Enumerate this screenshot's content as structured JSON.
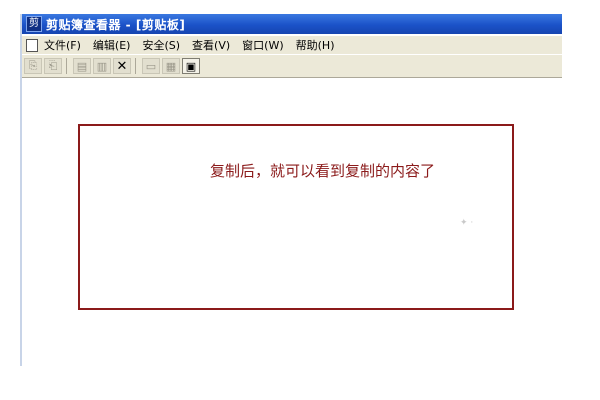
{
  "window": {
    "app_icon": "剪",
    "title": "剪贴簿查看器 - [剪贴板]"
  },
  "menubar": {
    "items": [
      {
        "label": "文件(F)"
      },
      {
        "label": "编辑(E)"
      },
      {
        "label": "安全(S)"
      },
      {
        "label": "查看(V)"
      },
      {
        "label": "窗口(W)"
      },
      {
        "label": "帮助(H)"
      }
    ]
  },
  "toolbar": {
    "buttons": [
      {
        "icon": "connect-icon",
        "glyph": "⎘"
      },
      {
        "icon": "disconnect-icon",
        "glyph": "⎗"
      },
      {
        "icon": "share-icon",
        "glyph": "▤"
      },
      {
        "icon": "stop-share-icon",
        "glyph": "▥"
      },
      {
        "icon": "delete-icon",
        "glyph": "✕"
      },
      {
        "icon": "view-icon",
        "glyph": "▭"
      },
      {
        "icon": "thumbnail-icon",
        "glyph": "▦"
      },
      {
        "icon": "page-view-icon",
        "glyph": "▣"
      }
    ]
  },
  "content": {
    "message": "复制后，就可以看到复制的内容了"
  },
  "colors": {
    "titlebar": "#1b52c8",
    "callout_border": "#8b1a1a",
    "callout_text": "#8b1a1a"
  }
}
